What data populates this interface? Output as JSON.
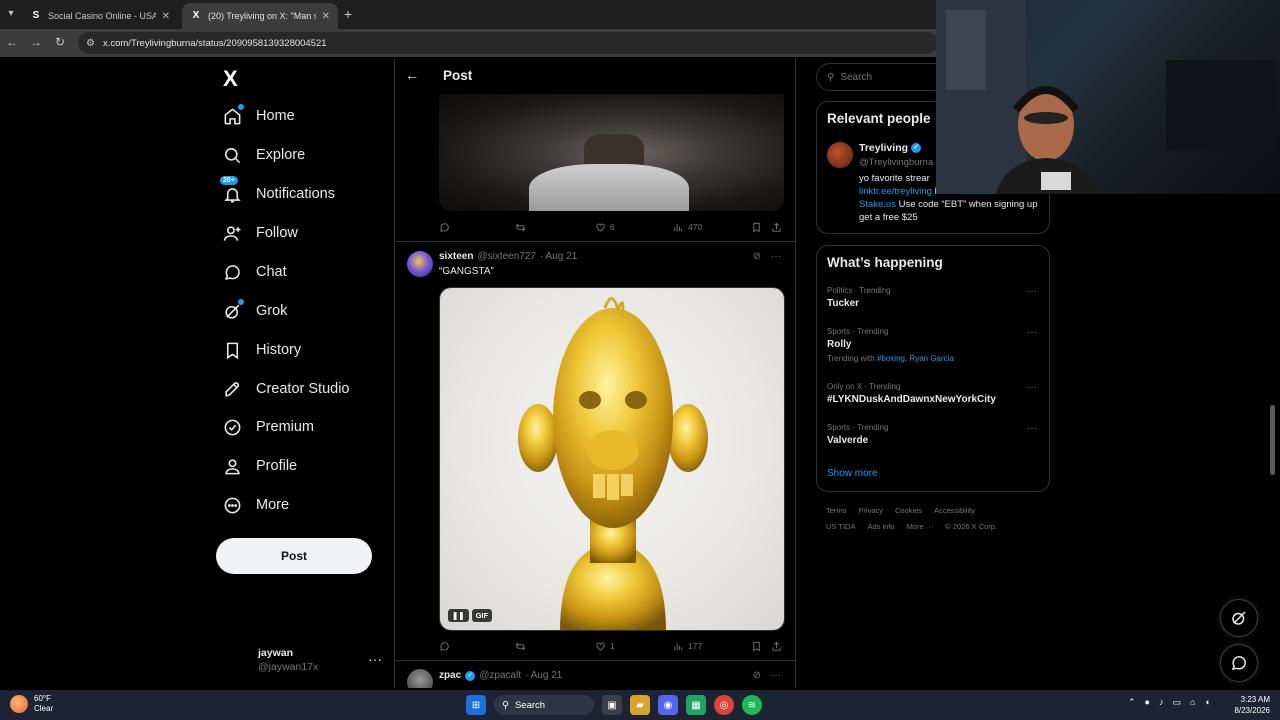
{
  "browser": {
    "tabs": [
      {
        "title": "Social Casino Online - USA's Be",
        "favicon": "S"
      },
      {
        "title": "(20) Treyliving on X: \"Man shut",
        "favicon": "X"
      }
    ],
    "url": "x.com/Treylivingburna/status/2090958139328004521"
  },
  "nav": {
    "logo": "X",
    "items": [
      {
        "label": "Home",
        "icon": "home-icon"
      },
      {
        "label": "Explore",
        "icon": "search-icon"
      },
      {
        "label": "Notifications",
        "icon": "bell-icon",
        "badge": "20+"
      },
      {
        "label": "Follow",
        "icon": "add-person-icon"
      },
      {
        "label": "Chat",
        "icon": "chat-icon"
      },
      {
        "label": "Grok",
        "icon": "grok-icon"
      },
      {
        "label": "History",
        "icon": "bookmark-icon"
      },
      {
        "label": "Creator Studio",
        "icon": "rocket-icon"
      },
      {
        "label": "Premium",
        "icon": "verified-icon"
      },
      {
        "label": "Profile",
        "icon": "person-icon"
      },
      {
        "label": "More",
        "icon": "more-circle-icon"
      }
    ],
    "post_button": "Post",
    "account": {
      "name": "jaywan",
      "handle": "@jaywan17x"
    }
  },
  "main": {
    "title": "Post",
    "tweet1_actions": {
      "replies": "",
      "reposts": "",
      "likes": "6",
      "views": "470"
    },
    "tweet2": {
      "name": "sixteen",
      "handle": "@sixteen727",
      "date": "· Aug 21",
      "text": "“GANGSTA”",
      "gif_label": "GIF",
      "actions": {
        "replies": "",
        "reposts": "",
        "likes": "1",
        "views": "177"
      }
    },
    "tweet3": {
      "name": "zpac",
      "handle": "@zpacalt",
      "date": "· Aug 21"
    }
  },
  "right": {
    "search_placeholder": "Search",
    "relevant": {
      "title": "Relevant people",
      "name": "Treyliving",
      "handle": "@Treylivingburna",
      "bio_1": "yo favorite strear",
      "bio_link1": "linktr.ee/treyliving",
      "bio_2": " Partnered with",
      "bio_link2": "Stake.us",
      "bio_3": " Use code “EBT” when signing up get a free $25"
    },
    "happening": {
      "title": "What’s happening",
      "trends": [
        {
          "category": "Politics · Trending",
          "name": "Tucker"
        },
        {
          "category": "Sports · Trending",
          "name": "Rolly",
          "with_prefix": "Trending with ",
          "with_links": "#boxing, Ryan Garcia"
        },
        {
          "category": "Only on X · Trending",
          "name": "#LYKNDuskAndDawnxNewYorkCity"
        },
        {
          "category": "Sports · Trending",
          "name": "Valverde"
        }
      ],
      "show_more": "Show more"
    },
    "footer_row1": [
      "Terms",
      "Privacy",
      "Cookies",
      "Accessibility"
    ],
    "footer_row2": [
      "US TIDA",
      "Ads info",
      "More ···",
      "© 2026 X Corp."
    ]
  },
  "taskbar": {
    "temp": "60°F",
    "condition": "Clear",
    "search": "Search",
    "time": "3:23 AM",
    "date": "8/23/2026"
  },
  "colors": {
    "accent": "#1d9bf0",
    "background": "#000000",
    "border": "#2f3336",
    "muted": "#71767b"
  }
}
